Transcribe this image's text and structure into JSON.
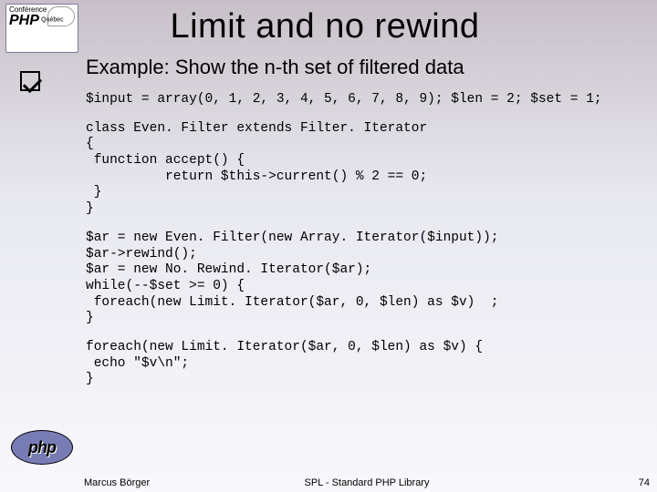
{
  "logo": {
    "line1": "Conférence",
    "php": "PHP",
    "suffix": "Québec",
    "bottom": "php"
  },
  "title": "Limit and no rewind",
  "subtitle": "Example: Show the n-th set of filtered data",
  "code": {
    "block1": "$input = array(0, 1, 2, 3, 4, 5, 6, 7, 8, 9); $len = 2; $set = 1;",
    "block2": "class Even. Filter extends Filter. Iterator\n{\n function accept() {\n          return $this->current() % 2 == 0;\n }\n}",
    "block3": "$ar = new Even. Filter(new Array. Iterator($input));\n$ar->rewind();\n$ar = new No. Rewind. Iterator($ar);\nwhile(--$set >= 0) {\n foreach(new Limit. Iterator($ar, 0, $len) as $v)  ;\n}",
    "block4": "foreach(new Limit. Iterator($ar, 0, $len) as $v) {\n echo \"$v\\n\";\n}"
  },
  "footer": {
    "author": "Marcus Börger",
    "center": "SPL - Standard PHP Library",
    "page": "74"
  }
}
